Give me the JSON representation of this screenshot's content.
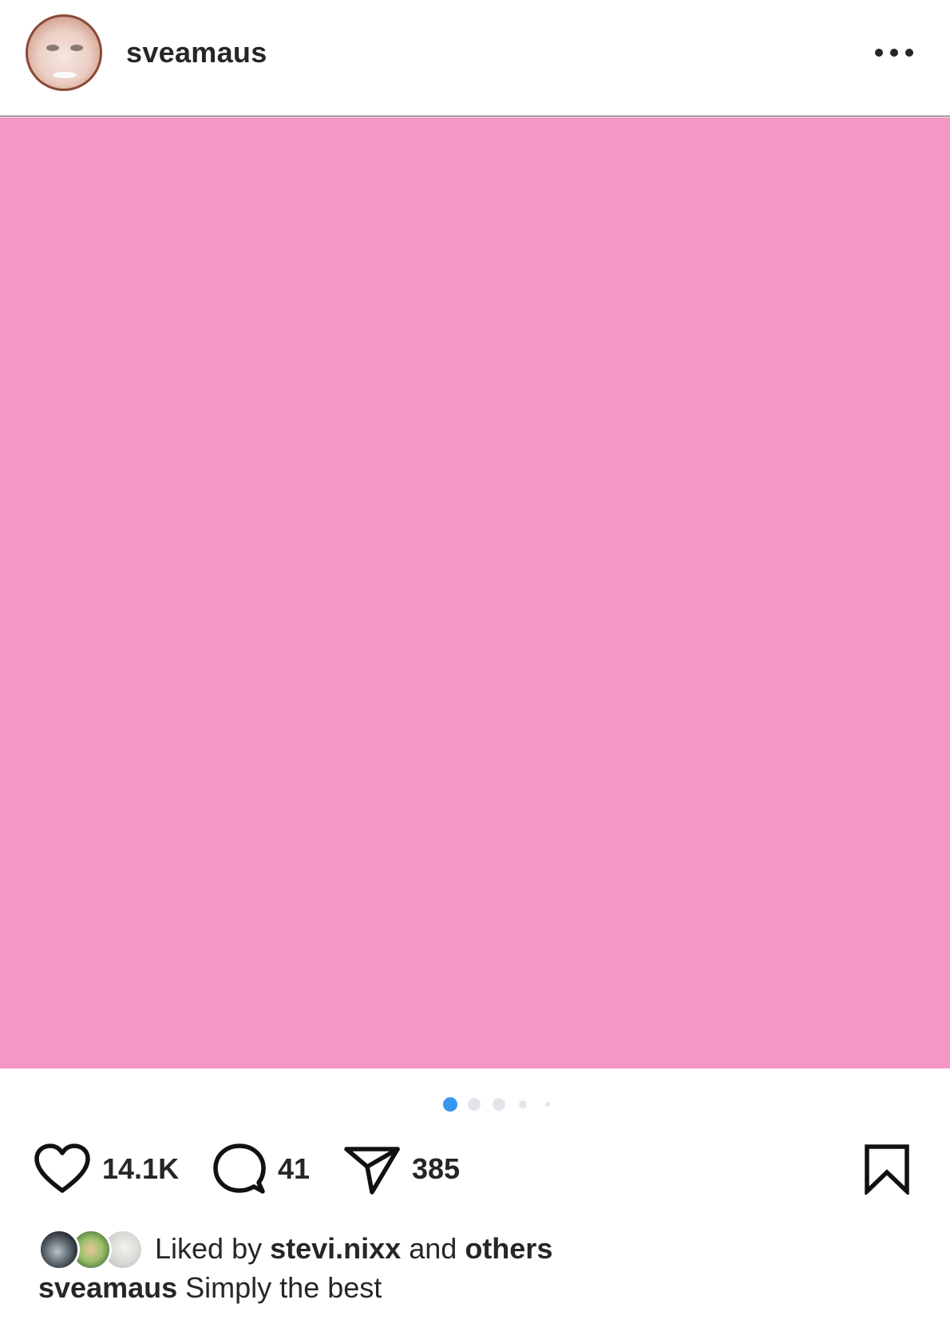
{
  "post": {
    "username": "sveamaus",
    "media_color": "#f297c6",
    "carousel": {
      "total": 5,
      "active_index": 0,
      "active_color": "#3797f0",
      "inactive_color": "#e2e6ea"
    }
  },
  "actions": {
    "likes": "14.1K",
    "comments": "41",
    "shares": "385"
  },
  "liked_by": {
    "prefix": "Liked by",
    "user": "stevi.nixx",
    "joiner": "and",
    "others": "others"
  },
  "caption": {
    "username": "sveamaus",
    "text": "Simply the best"
  },
  "icons": {
    "more": "more-horizontal-icon",
    "like": "heart-icon",
    "comment": "comment-bubble-icon",
    "share": "paper-plane-icon",
    "save": "bookmark-icon"
  }
}
